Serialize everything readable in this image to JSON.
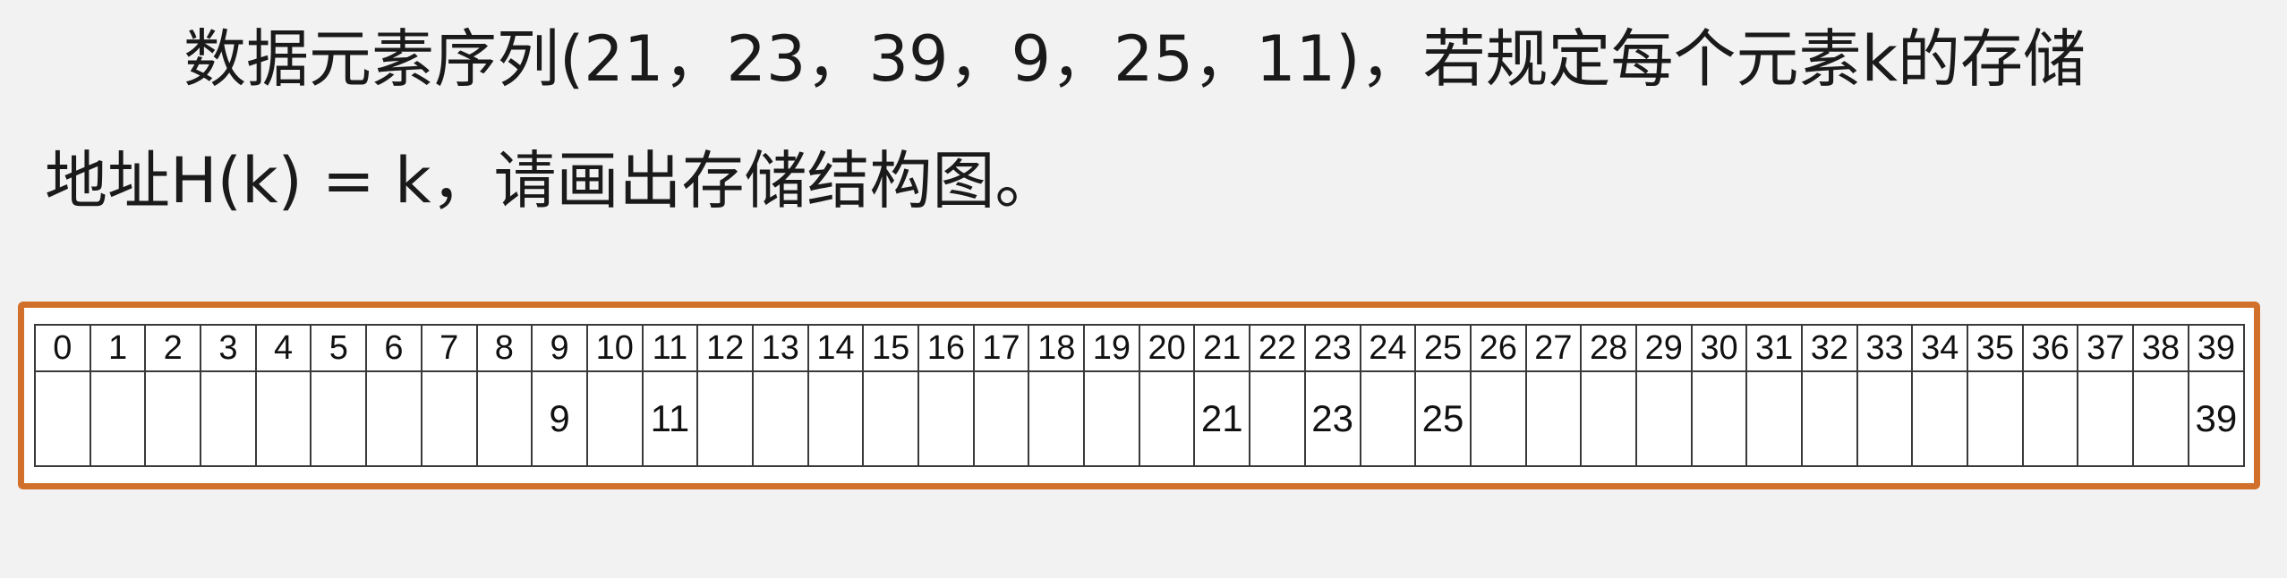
{
  "question": {
    "line1": "数据元素序列(21，23，39，9，25，11)，若规定每个元素k的存储",
    "line2": "地址H(k) = k，请画出存储结构图。"
  },
  "frame_color": "#d0702a",
  "storage": {
    "indices": [
      "0",
      "1",
      "2",
      "3",
      "4",
      "5",
      "6",
      "7",
      "8",
      "9",
      "10",
      "11",
      "12",
      "13",
      "14",
      "15",
      "16",
      "17",
      "18",
      "19",
      "20",
      "21",
      "22",
      "23",
      "24",
      "25",
      "26",
      "27",
      "28",
      "29",
      "30",
      "31",
      "32",
      "33",
      "34",
      "35",
      "36",
      "37",
      "38",
      "39"
    ],
    "values": [
      "",
      "",
      "",
      "",
      "",
      "",
      "",
      "",
      "",
      "9",
      "",
      "11",
      "",
      "",
      "",
      "",
      "",
      "",
      "",
      "",
      "",
      "21",
      "",
      "23",
      "",
      "25",
      "",
      "",
      "",
      "",
      "",
      "",
      "",
      "",
      "",
      "",
      "",
      "",
      "",
      "39"
    ]
  }
}
